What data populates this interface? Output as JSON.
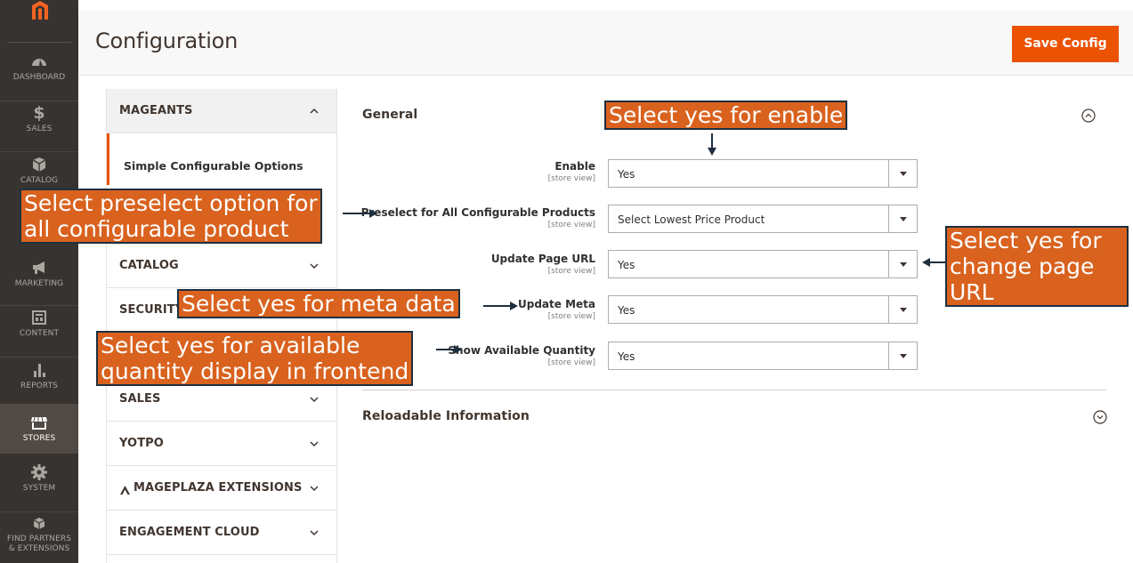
{
  "nav": {
    "items": [
      {
        "name": "dashboard",
        "label": "DASHBOARD"
      },
      {
        "name": "sales",
        "label": "SALES"
      },
      {
        "name": "catalog",
        "label": "CATALOG"
      },
      {
        "name": "marketing",
        "label": "MARKETING"
      },
      {
        "name": "content",
        "label": "CONTENT"
      },
      {
        "name": "reports",
        "label": "REPORTS"
      },
      {
        "name": "stores",
        "label": "STORES"
      },
      {
        "name": "system",
        "label": "SYSTEM"
      },
      {
        "name": "find-partners",
        "label_line1": "FIND PARTNERS",
        "label_line2": "& EXTENSIONS"
      }
    ],
    "sales_symbol": "$"
  },
  "header": {
    "title": "Configuration",
    "save_label": "Save Config"
  },
  "tabs": {
    "items": [
      {
        "label": "MAGEANTS",
        "expanded": true
      },
      {
        "label": "CATALOG",
        "expanded": false
      },
      {
        "label": "SECURITY",
        "expanded": false
      },
      {
        "label": "SALES",
        "expanded": false
      },
      {
        "label": "YOTPO",
        "expanded": false
      },
      {
        "label": "MAGEPLAZA EXTENSIONS",
        "expanded": false
      },
      {
        "label": "ENGAGEMENT CLOUD",
        "expanded": false
      }
    ],
    "sub_item": "Simple Configurable Options"
  },
  "general": {
    "title": "General",
    "fields": [
      {
        "label": "Enable",
        "scope": "[store view]",
        "value": "Yes"
      },
      {
        "label": "Preselect for All Configurable Products",
        "scope": "[store view]",
        "value": "Select Lowest Price Product"
      },
      {
        "label": "Update Page URL",
        "scope": "[store view]",
        "value": "Yes"
      },
      {
        "label": "Update Meta",
        "scope": "[store view]",
        "value": "Yes"
      },
      {
        "label": "Show Available Quantity",
        "scope": "[store view]",
        "value": "Yes"
      }
    ]
  },
  "reloadable": {
    "title": "Reloadable Information"
  },
  "callouts": {
    "enable": "Select yes for enable",
    "preselect_line1": "Select preselect option for",
    "preselect_line2": "all configurable product",
    "url_line1": "Select yes for",
    "url_line2": "change page",
    "url_line3": "URL",
    "meta": "Select yes for meta data",
    "qty_line1": "Select yes for available",
    "qty_line2": "quantity display in frontend"
  },
  "colors": {
    "nav_bg": "#373330",
    "accent": "#eb5202",
    "callout_bg": "#d9621e",
    "callout_border": "#1e3040"
  }
}
